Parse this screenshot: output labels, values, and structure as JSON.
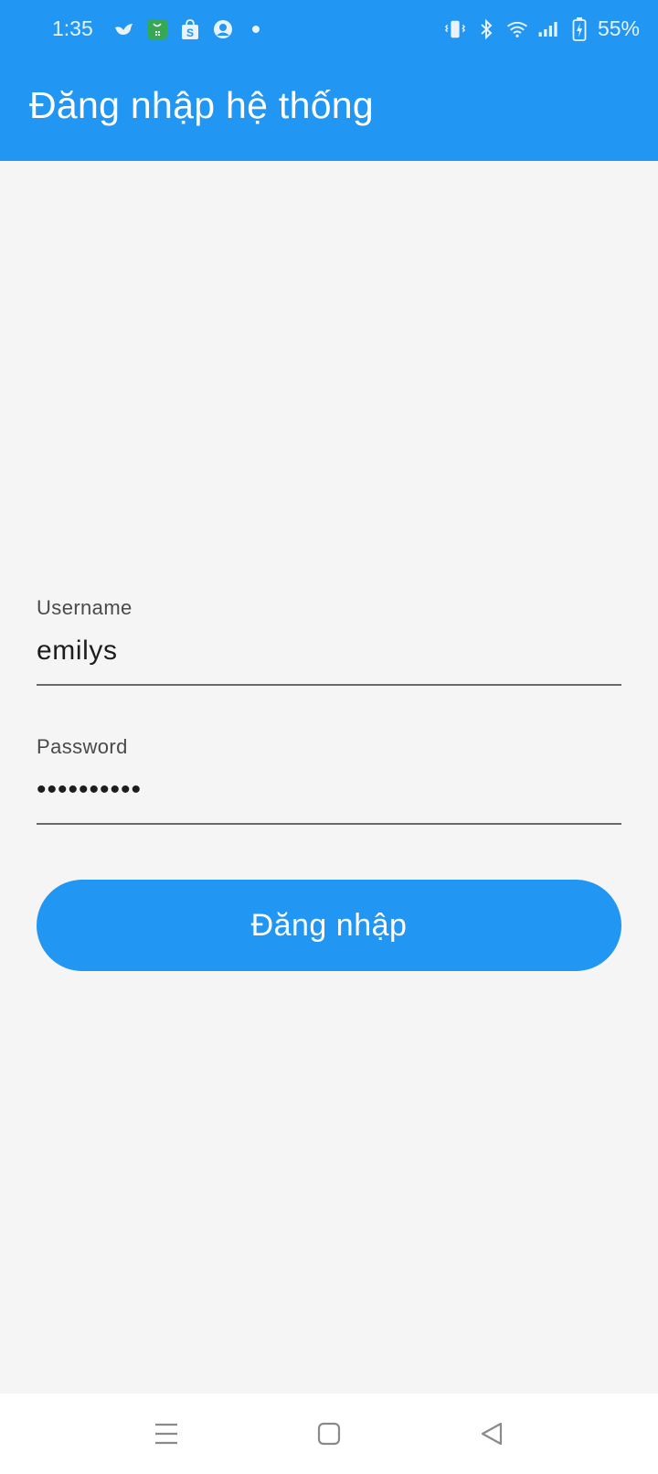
{
  "status_bar": {
    "time": "1:35",
    "battery": "55%",
    "left_icons": [
      "bird-app-icon",
      "shopping-bag-green-icon",
      "shopee-icon",
      "account-circle-icon",
      "notification-dot-icon"
    ],
    "right_icons": [
      "vibrate-icon",
      "bluetooth-icon",
      "wifi-icon",
      "signal-icon",
      "battery-charging-icon"
    ]
  },
  "app_bar": {
    "title": "Đăng nhập hệ thống"
  },
  "form": {
    "username": {
      "label": "Username",
      "value": "emilys"
    },
    "password": {
      "label": "Password",
      "value": "••••••••••"
    },
    "login_label": "Đăng nhập"
  },
  "colors": {
    "primary": "#2196f3",
    "background": "#f5f5f5",
    "underline": "#6b6b6b",
    "text": "#1d1d1d"
  },
  "nav_bar": {
    "buttons": [
      "menu-icon",
      "home-icon",
      "back-icon"
    ]
  }
}
